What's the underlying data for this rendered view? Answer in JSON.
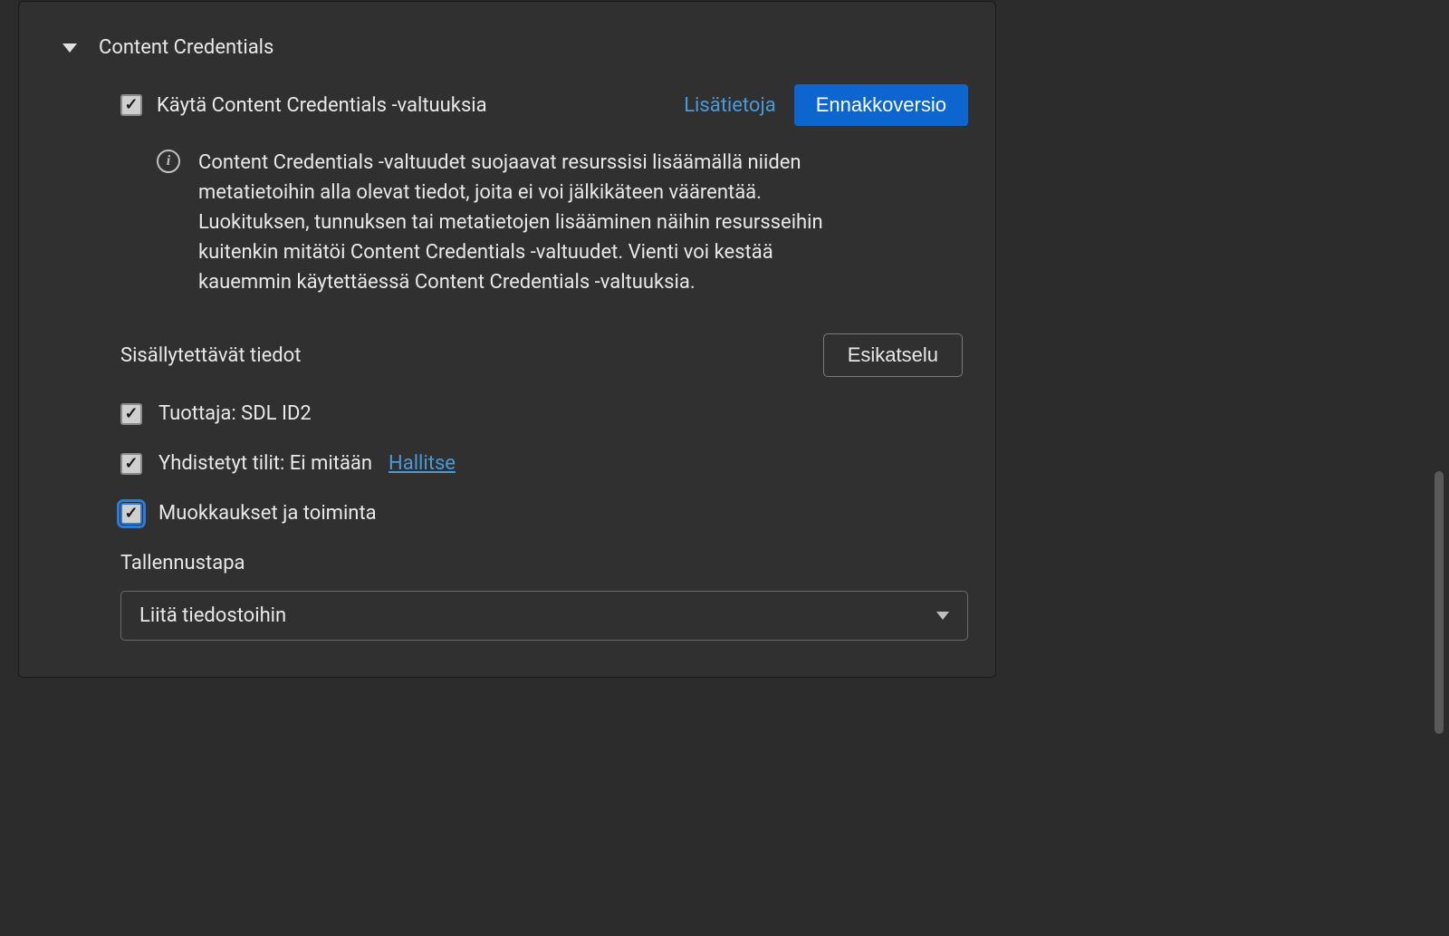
{
  "section": {
    "title": "Content Credentials",
    "enable_label": "Käytä Content Credentials -valtuuksia",
    "more_info_link": "Lisätietoja",
    "preview_badge": "Ennakkoversio",
    "info_text": "Content Credentials -valtuudet suojaavat resurssisi lisäämällä niiden metatietoihin alla olevat tiedot, joita ei voi jälkikäteen väärentää. Luokituksen, tunnuksen tai metatietojen lisääminen näihin resursseihin kuitenkin mitätöi Content Credentials -valtuudet. Vienti voi kestää kauemmin käytettäessä Content Credentials -valtuuksia.",
    "included_info_heading": "Sisällytettävät tiedot",
    "preview_button": "Esikatselu",
    "producer_label": "Tuottaja: SDL ID2",
    "connected_accounts_label": "Yhdistetyt tilit: Ei mitään",
    "manage_link": "Hallitse",
    "edits_activity_label": "Muokkaukset ja toiminta",
    "storage_method_label": "Tallennustapa",
    "storage_dropdown_value": "Liitä tiedostoihin"
  }
}
